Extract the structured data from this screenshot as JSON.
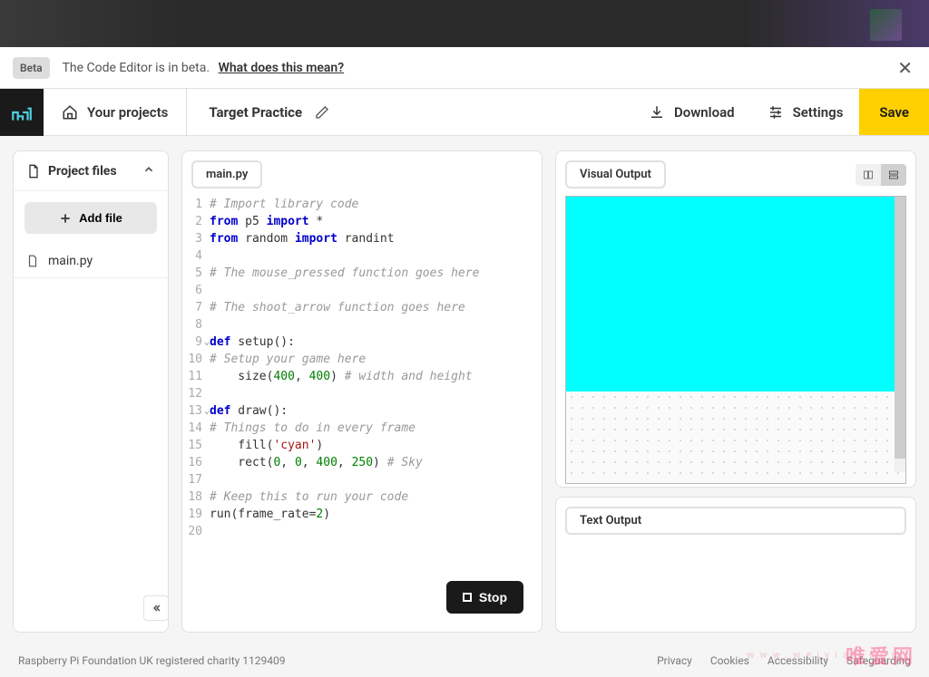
{
  "beta": {
    "badge": "Beta",
    "message": "The Code Editor is in beta.",
    "link": "What does this mean?"
  },
  "toolbar": {
    "projects": "Your projects",
    "title": "Target Practice",
    "download": "Download",
    "settings": "Settings",
    "save": "Save"
  },
  "sidebar": {
    "title": "Project files",
    "add_file": "Add file",
    "files": [
      {
        "name": "main.py"
      }
    ]
  },
  "editor": {
    "tab": "main.py",
    "stop": "Stop",
    "lines": [
      {
        "n": "1",
        "html": "<span class='c-comment'># Import library code</span>"
      },
      {
        "n": "2",
        "html": "<span class='c-keyword'>from</span> p5 <span class='c-keyword'>import</span> *"
      },
      {
        "n": "3",
        "html": "<span class='c-keyword'>from</span> random <span class='c-keyword'>import</span> randint"
      },
      {
        "n": "4",
        "html": ""
      },
      {
        "n": "5",
        "html": "<span class='c-comment'># The mouse_pressed function goes here</span>"
      },
      {
        "n": "6",
        "html": ""
      },
      {
        "n": "7",
        "html": "<span class='c-comment'># The shoot_arrow function goes here</span>"
      },
      {
        "n": "8",
        "html": ""
      },
      {
        "n": "9",
        "html": "<span class='c-keyword'>def</span> setup():",
        "fold": true
      },
      {
        "n": "10",
        "html": "<span class='c-comment'># Setup your game here</span>"
      },
      {
        "n": "11",
        "html": "    size(<span class='c-number'>400</span>, <span class='c-number'>400</span>) <span class='c-comment'># width and height</span>"
      },
      {
        "n": "12",
        "html": ""
      },
      {
        "n": "13",
        "html": "<span class='c-keyword'>def</span> draw():",
        "fold": true
      },
      {
        "n": "14",
        "html": "<span class='c-comment'># Things to do in every frame</span>"
      },
      {
        "n": "15",
        "html": "    fill(<span class='c-string'>'cyan'</span>)"
      },
      {
        "n": "16",
        "html": "    rect(<span class='c-number'>0</span>, <span class='c-number'>0</span>, <span class='c-number'>400</span>, <span class='c-number'>250</span>) <span class='c-comment'># Sky</span>"
      },
      {
        "n": "17",
        "html": ""
      },
      {
        "n": "18",
        "html": "<span class='c-comment'># Keep this to run your code</span>"
      },
      {
        "n": "19",
        "html": "run(frame_rate=<span class='c-number'>2</span>)"
      },
      {
        "n": "20",
        "html": ""
      }
    ]
  },
  "output": {
    "visual_tab": "Visual Output",
    "text_tab": "Text Output",
    "sky_color": "#00ffff"
  },
  "footer": {
    "charity": "Raspberry Pi Foundation UK registered charity 1129409",
    "links": [
      "Privacy",
      "Cookies",
      "Accessibility",
      "Safeguarding"
    ]
  },
  "watermark": {
    "text": "唯爱网",
    "url": "www.weiyiai.com"
  }
}
